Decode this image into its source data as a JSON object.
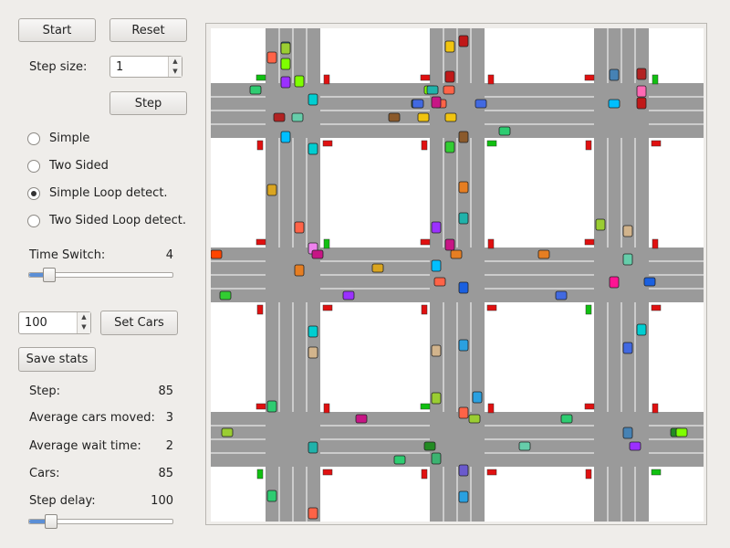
{
  "controls": {
    "start_label": "Start",
    "reset_label": "Reset",
    "step_size_label": "Step size:",
    "step_size_value": "1",
    "step_label": "Step",
    "modes": [
      {
        "label": "Simple",
        "checked": false
      },
      {
        "label": "Two Sided",
        "checked": false
      },
      {
        "label": "Simple Loop detect.",
        "checked": true
      },
      {
        "label": "Two Sided Loop detect.",
        "checked": false
      }
    ],
    "time_switch_label": "Time Switch:",
    "time_switch_value": "4",
    "time_switch_level": 0.1,
    "cars_input_value": "100",
    "set_cars_label": "Set Cars",
    "save_stats_label": "Save stats"
  },
  "stats": {
    "step_label": "Step:",
    "step_value": "85",
    "avg_moved_label": "Average cars moved:",
    "avg_moved_value": "3",
    "avg_wait_label": "Average wait time:",
    "avg_wait_value": "2",
    "cars_label": "Cars:",
    "cars_value": "85",
    "step_delay_label": "Step delay:",
    "step_delay_value": "100",
    "step_delay_level": 0.12
  },
  "colors": {
    "road": "#9a9a9a",
    "block": "#ffffff",
    "lane_line": "#ffffff",
    "light_red": "#e01010",
    "light_green": "#10c010",
    "slider_fill": "#5b8fd6"
  },
  "simulation": {
    "grid_columns": 3,
    "grid_rows": 4,
    "car_count": 85,
    "car_colors": [
      "#c01818",
      "#1a60e0",
      "#2aa0e0",
      "#9acd32",
      "#9b30ff",
      "#ff69b4",
      "#2ecc71",
      "#f1c40f",
      "#e67e22",
      "#8b5a2b",
      "#00ced1",
      "#228b22",
      "#ff1493",
      "#4169e1",
      "#7fff00",
      "#d2b48c",
      "#00bfff",
      "#ff4500",
      "#6a5acd",
      "#3cb371",
      "#ee82ee",
      "#daa520",
      "#20b2aa",
      "#b22222",
      "#7b68ee",
      "#32cd32",
      "#ff6347",
      "#4682b4",
      "#c71585",
      "#66cdaa"
    ]
  }
}
